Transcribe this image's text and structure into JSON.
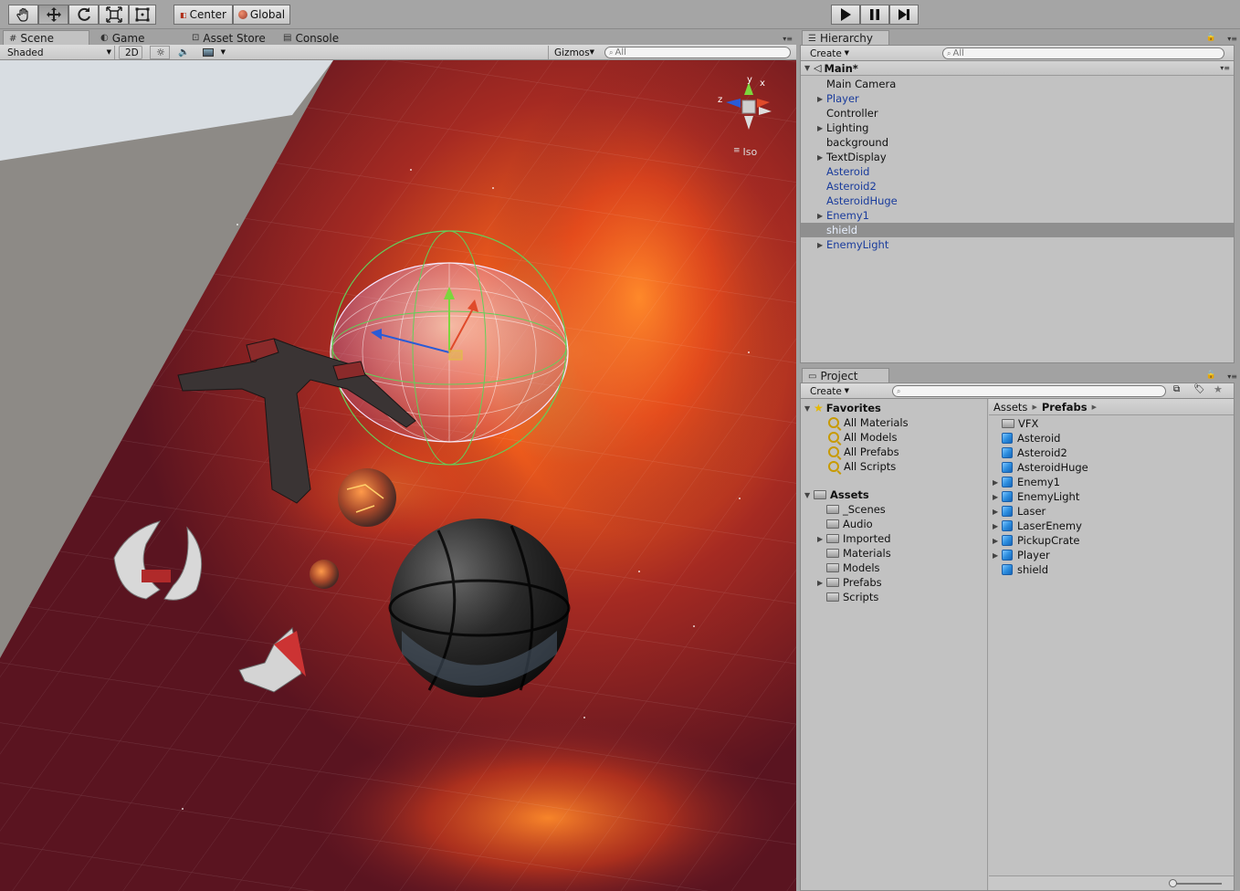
{
  "toolbar": {
    "tools": [
      "hand-tool",
      "move-tool",
      "rotate-tool",
      "scale-tool",
      "rect-tool"
    ],
    "active_tool": "move-tool",
    "pivot_label": "Center",
    "space_label": "Global"
  },
  "scene_tabs": [
    {
      "label": "Scene",
      "icon": "#"
    },
    {
      "label": "Game",
      "icon": "◐"
    },
    {
      "label": "Asset Store",
      "icon": "⊡"
    },
    {
      "label": "Console",
      "icon": "▤"
    }
  ],
  "scene_bar": {
    "shading_mode": "Shaded",
    "mode_2d": "2D",
    "gizmos_label": "Gizmos",
    "search_placeholder": "All"
  },
  "scene_gizmo": {
    "y_label": "y",
    "x_label": "x",
    "z_label": "z",
    "projection_label": "Iso"
  },
  "hierarchy": {
    "tab_label": "Hierarchy",
    "create_label": "Create",
    "search_placeholder": "All",
    "scene_name": "Main*",
    "items": [
      {
        "label": "Main Camera",
        "expandable": false,
        "prefab": false,
        "selected": false
      },
      {
        "label": "Player",
        "expandable": true,
        "prefab": true,
        "selected": false
      },
      {
        "label": "Controller",
        "expandable": false,
        "prefab": false,
        "selected": false
      },
      {
        "label": "Lighting",
        "expandable": true,
        "prefab": false,
        "selected": false
      },
      {
        "label": "background",
        "expandable": false,
        "prefab": false,
        "selected": false
      },
      {
        "label": "TextDisplay",
        "expandable": true,
        "prefab": false,
        "selected": false
      },
      {
        "label": "Asteroid",
        "expandable": false,
        "prefab": true,
        "selected": false
      },
      {
        "label": "Asteroid2",
        "expandable": false,
        "prefab": true,
        "selected": false
      },
      {
        "label": "AsteroidHuge",
        "expandable": false,
        "prefab": true,
        "selected": false
      },
      {
        "label": "Enemy1",
        "expandable": true,
        "prefab": true,
        "selected": false
      },
      {
        "label": "shield",
        "expandable": false,
        "prefab": true,
        "selected": true
      },
      {
        "label": "EnemyLight",
        "expandable": true,
        "prefab": true,
        "selected": false
      }
    ]
  },
  "project": {
    "tab_label": "Project",
    "create_label": "Create",
    "favorites_label": "Favorites",
    "favorites": [
      "All Materials",
      "All Models",
      "All Prefabs",
      "All Scripts"
    ],
    "assets_label": "Assets",
    "folders": [
      {
        "label": "_Scenes",
        "expandable": false
      },
      {
        "label": "Audio",
        "expandable": false
      },
      {
        "label": "Imported",
        "expandable": true
      },
      {
        "label": "Materials",
        "expandable": false
      },
      {
        "label": "Models",
        "expandable": false
      },
      {
        "label": "Prefabs",
        "expandable": true
      },
      {
        "label": "Scripts",
        "expandable": false
      }
    ],
    "breadcrumb": [
      "Assets",
      "Prefabs"
    ],
    "files": [
      {
        "label": "VFX",
        "type": "folder",
        "expandable": false
      },
      {
        "label": "Asteroid",
        "type": "prefab",
        "expandable": false
      },
      {
        "label": "Asteroid2",
        "type": "prefab",
        "expandable": false
      },
      {
        "label": "AsteroidHuge",
        "type": "prefab",
        "expandable": false
      },
      {
        "label": "Enemy1",
        "type": "prefab",
        "expandable": true
      },
      {
        "label": "EnemyLight",
        "type": "prefab",
        "expandable": true
      },
      {
        "label": "Laser",
        "type": "prefab",
        "expandable": true
      },
      {
        "label": "LaserEnemy",
        "type": "prefab",
        "expandable": true
      },
      {
        "label": "PickupCrate",
        "type": "prefab",
        "expandable": true
      },
      {
        "label": "Player",
        "type": "prefab",
        "expandable": true
      },
      {
        "label": "shield",
        "type": "prefab",
        "expandable": false
      }
    ]
  },
  "colors": {
    "prefab_text": "#1a3c9c",
    "selection": "#8f8f8f",
    "panel_bg": "#c2c2c2",
    "nebula_red": "#7b1f2b",
    "nebula_orange": "#e8531b"
  }
}
